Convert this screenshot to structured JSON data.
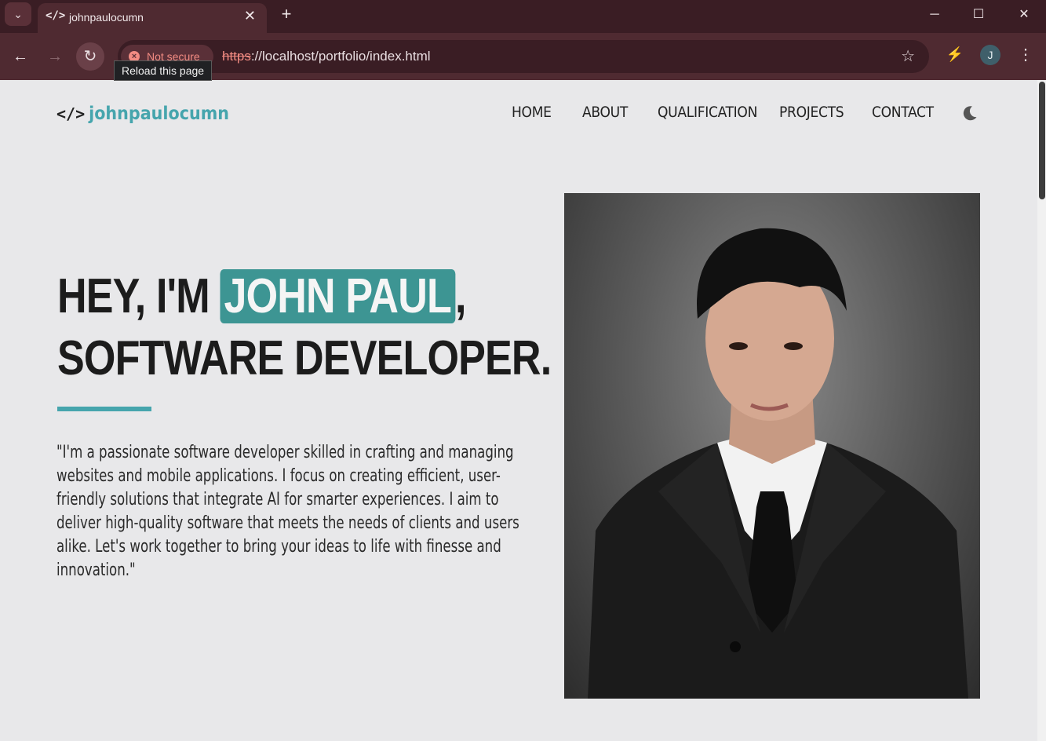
{
  "browser": {
    "tab_title": "johnpaulocumn",
    "security_label": "Not secure",
    "url_scheme": "https",
    "url_rest": "://localhost/portfolio/index.html",
    "tooltip": "Reload this page",
    "avatar_letter": "J"
  },
  "site": {
    "brand": "johnpaulocumn",
    "nav": [
      "HOME",
      "ABOUT",
      "QUALIFICATION",
      "PROJECTS",
      "CONTACT"
    ],
    "hero_prefix": "HEY, I'M ",
    "hero_name": "JOHN PAUL",
    "hero_comma": ",",
    "hero_line2": "SOFTWARE DEVELOPER.",
    "description": "\"I'm a passionate software developer skilled in crafting and managing websites and mobile applications. I focus on creating efficient, user-friendly solutions that integrate AI for smarter experiences. I aim to deliver high-quality software that meets the needs of clients and users alike. Let's work together to bring your ideas to life with finesse and innovation.\"",
    "accent_color": "#46a5ad",
    "highlight_color": "#3d9593"
  }
}
